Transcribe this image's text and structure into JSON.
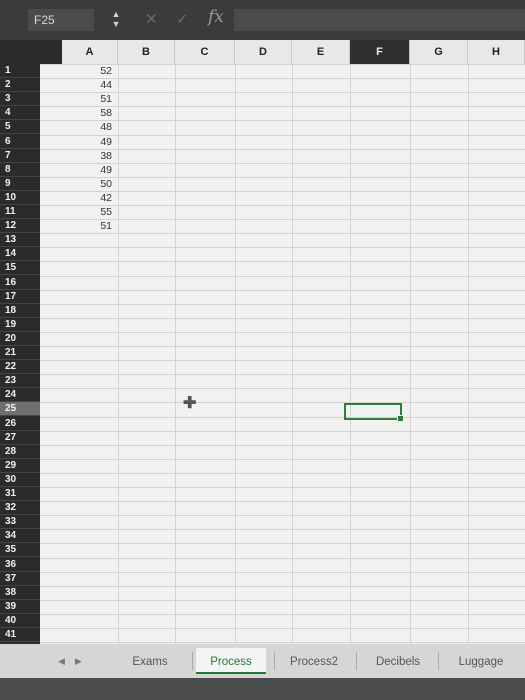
{
  "formula_bar": {
    "name_box": "F25",
    "stepper_icon": "up-down-stepper-icon",
    "cancel_icon": "x-icon",
    "confirm_icon": "check-icon",
    "fx_label": "fx",
    "formula_value": ""
  },
  "columns": [
    "A",
    "B",
    "C",
    "D",
    "E",
    "F",
    "G",
    "H"
  ],
  "selected_column": "F",
  "rows": [
    "1",
    "2",
    "3",
    "4",
    "5",
    "6",
    "7",
    "8",
    "9",
    "10",
    "11",
    "12",
    "13",
    "14",
    "15",
    "16",
    "17",
    "18",
    "19",
    "20",
    "21",
    "22",
    "23",
    "24",
    "25",
    "26",
    "27",
    "28",
    "29",
    "30",
    "31",
    "32",
    "33",
    "34",
    "35",
    "36",
    "37",
    "38",
    "39",
    "40",
    "41"
  ],
  "active_row": "25",
  "column_a_values": [
    "52",
    "44",
    "51",
    "58",
    "48",
    "49",
    "38",
    "49",
    "50",
    "42",
    "55",
    "51"
  ],
  "selected_cell": "F25",
  "sheet_tabs": [
    "Exams",
    "Process",
    "Process2",
    "Decibels",
    "Luggage"
  ],
  "active_tab": "Process",
  "colors": {
    "accent_green": "#1f7a38",
    "row_header_bg": "#2a2b2c",
    "grid_line": "#d2d3d1"
  }
}
